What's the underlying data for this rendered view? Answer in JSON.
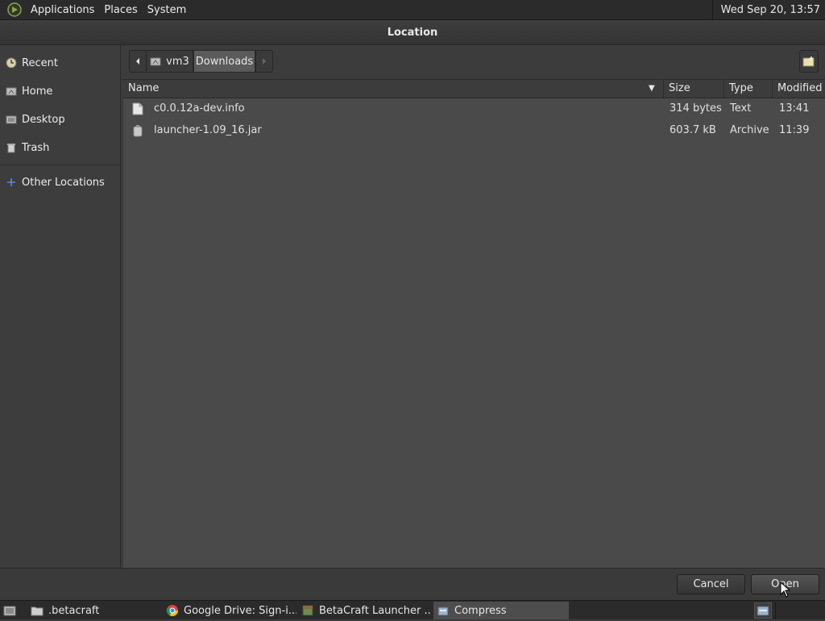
{
  "top_panel": {
    "menus": [
      "Applications",
      "Places",
      "System"
    ],
    "clock": "Wed Sep 20, 13:57"
  },
  "dialog": {
    "title": "Location",
    "sidebar": {
      "items": [
        {
          "label": "Recent",
          "icon": "recent-icon"
        },
        {
          "label": "Home",
          "icon": "home-icon"
        },
        {
          "label": "Desktop",
          "icon": "desktop-icon"
        },
        {
          "label": "Trash",
          "icon": "trash-icon"
        },
        {
          "label": "Other Locations",
          "icon": "plus-icon"
        }
      ]
    },
    "path_bar": {
      "crumbs": [
        "vm3",
        "Downloads"
      ],
      "active": "Downloads"
    },
    "columns": [
      "Name",
      "Size",
      "Type",
      "Modified"
    ],
    "sort_column": "Name",
    "files": [
      {
        "name": "c0.0.12a-dev.info",
        "size": "314 bytes",
        "type": "Text",
        "modified": "13:41",
        "icon": "text-file-icon"
      },
      {
        "name": "launcher-1.09_16.jar",
        "size": "603.7 kB",
        "type": "Archive",
        "modified": "11:39",
        "icon": "archive-file-icon"
      }
    ],
    "buttons": {
      "cancel": "Cancel",
      "open": "Open"
    }
  },
  "taskbar": {
    "tasks": [
      {
        "label": ".betacraft",
        "icon": "folder-icon",
        "active": false
      },
      {
        "label": "Google Drive: Sign-i...",
        "icon": "chrome-icon",
        "active": false
      },
      {
        "label": "BetaCraft Launcher ...",
        "icon": "betacraft-icon",
        "active": false
      },
      {
        "label": "Compress",
        "icon": "compress-icon",
        "active": true
      }
    ]
  },
  "colors": {
    "panel": "#2b2b2b",
    "window": "#3c3c3c",
    "list": "#4a4a4a",
    "accent": "#4a90d9"
  }
}
